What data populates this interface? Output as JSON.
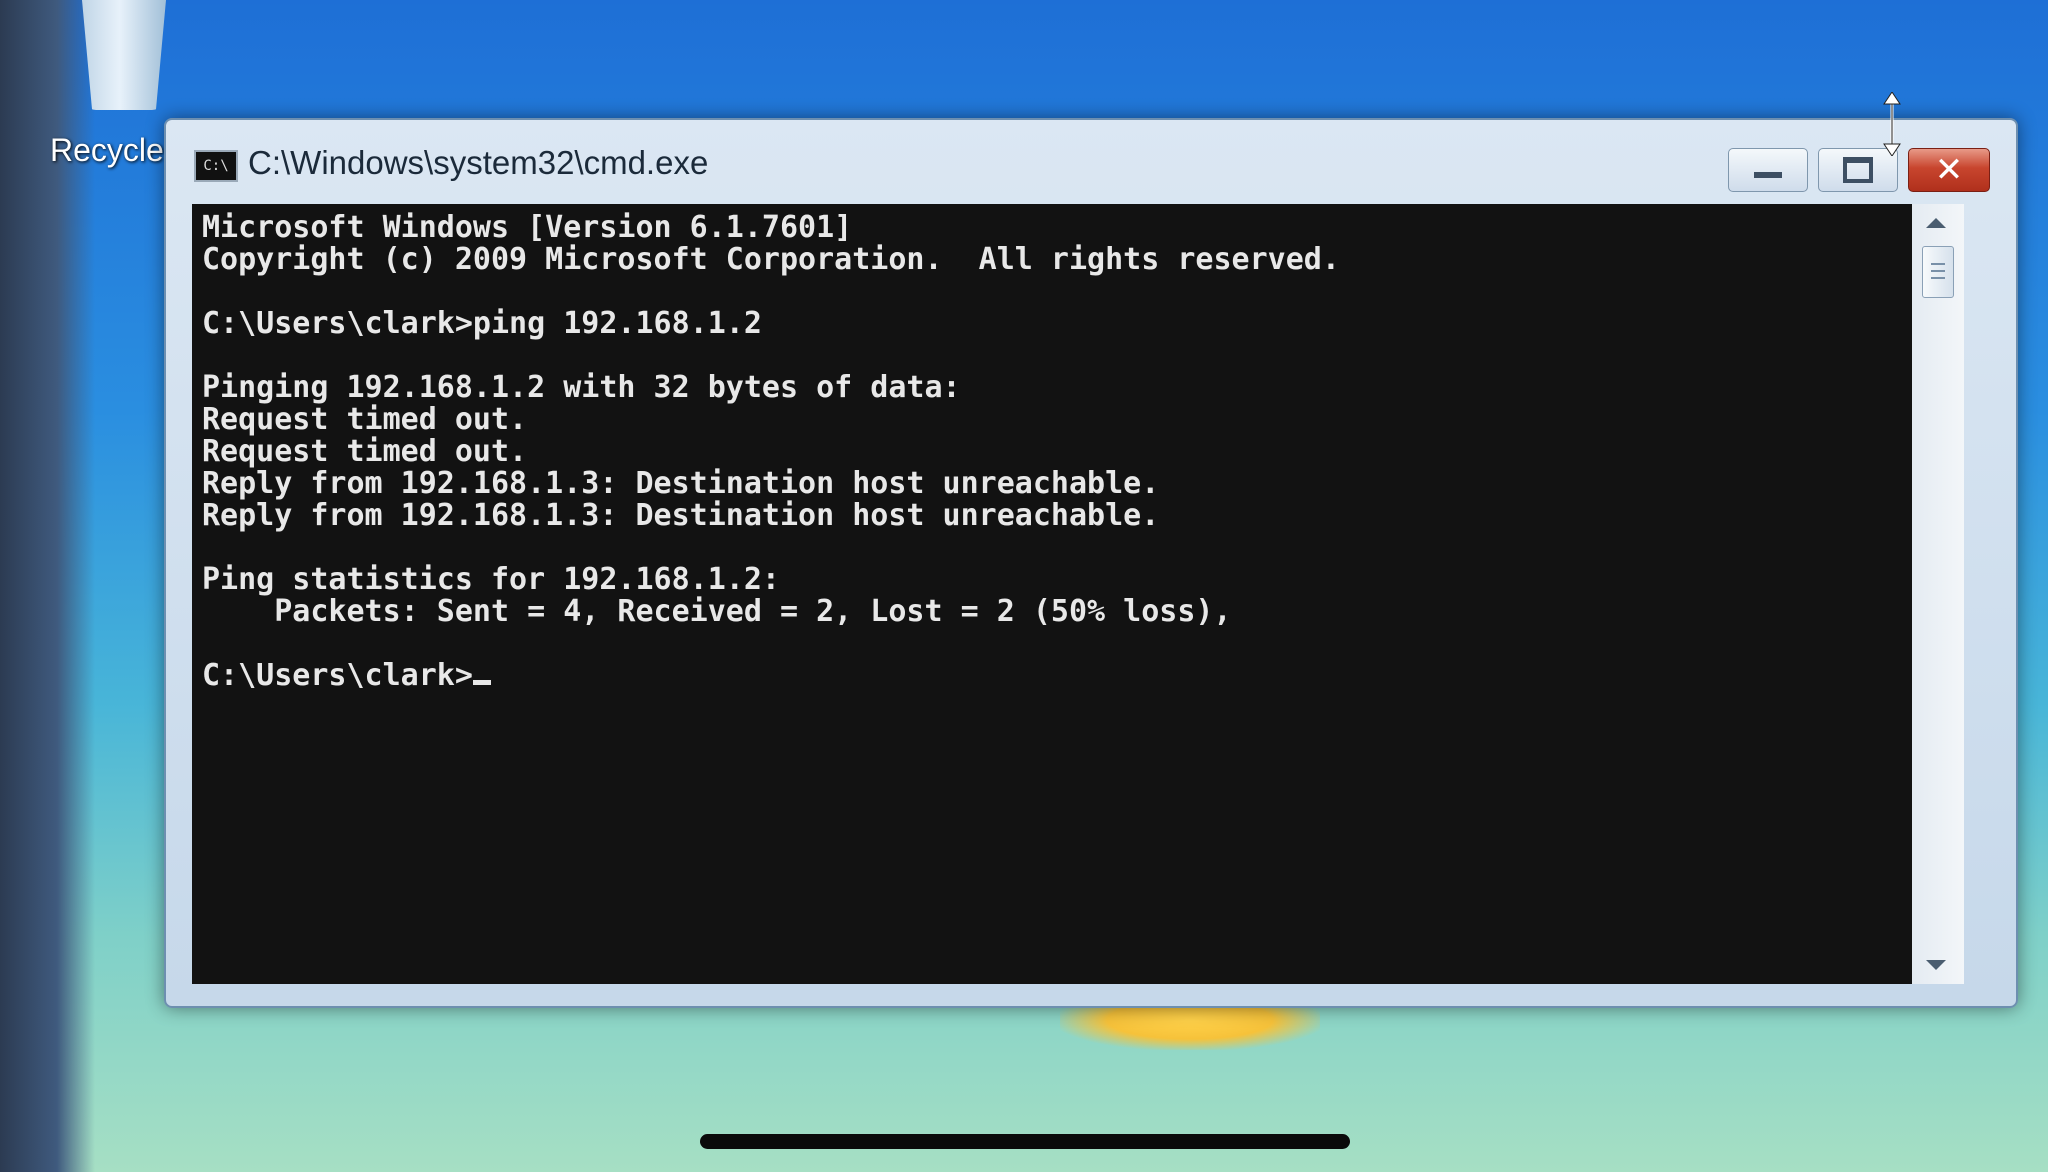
{
  "desktop": {
    "recycle_bin_label": "Recycle"
  },
  "window": {
    "title": "C:\\Windows\\system32\\cmd.exe",
    "icon_label": "C:\\",
    "buttons": {
      "minimize": "minimize",
      "maximize": "maximize",
      "close": "close"
    }
  },
  "console": {
    "lines": [
      "Microsoft Windows [Version 6.1.7601]",
      "Copyright (c) 2009 Microsoft Corporation.  All rights reserved.",
      "",
      "C:\\Users\\clark>ping 192.168.1.2",
      "",
      "Pinging 192.168.1.2 with 32 bytes of data:",
      "Request timed out.",
      "Request timed out.",
      "Reply from 192.168.1.3: Destination host unreachable.",
      "Reply from 192.168.1.3: Destination host unreachable.",
      "",
      "Ping statistics for 192.168.1.2:",
      "    Packets: Sent = 4, Received = 2, Lost = 2 (50% loss),",
      ""
    ],
    "prompt": "C:\\Users\\clark>"
  },
  "colors": {
    "console_bg": "#121212",
    "console_fg": "#e8e8e8",
    "close_button": "#c8452e",
    "desktop_accent": "#2a8ee0"
  },
  "icons": [
    "recycle-bin-icon",
    "cmd-icon",
    "minimize-icon",
    "maximize-icon",
    "close-icon",
    "scroll-up-icon",
    "scroll-down-icon",
    "resize-cursor-icon"
  ]
}
